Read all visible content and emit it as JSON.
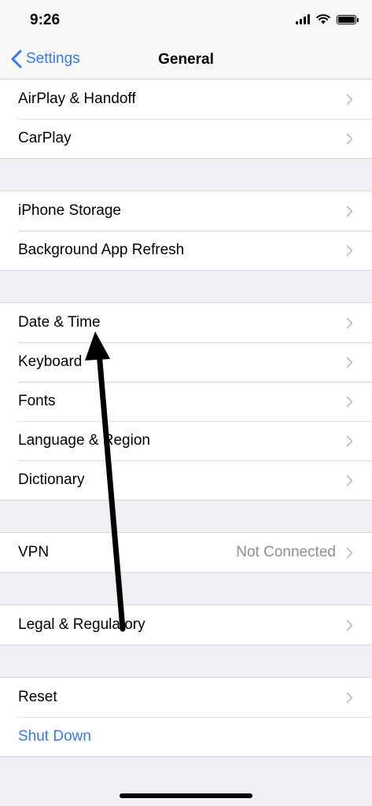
{
  "status_bar": {
    "time": "9:26"
  },
  "nav": {
    "back_label": "Settings",
    "title": "General"
  },
  "groups": {
    "g1": [
      {
        "label": "AirPlay & Handoff"
      },
      {
        "label": "CarPlay"
      }
    ],
    "g2": [
      {
        "label": "iPhone Storage"
      },
      {
        "label": "Background App Refresh"
      }
    ],
    "g3": [
      {
        "label": "Date & Time"
      },
      {
        "label": "Keyboard"
      },
      {
        "label": "Fonts"
      },
      {
        "label": "Language & Region"
      },
      {
        "label": "Dictionary"
      }
    ],
    "g4": [
      {
        "label": "VPN",
        "value": "Not Connected"
      }
    ],
    "g5": [
      {
        "label": "Legal & Regulatory"
      }
    ],
    "g6": [
      {
        "label": "Reset"
      },
      {
        "label": "Shut Down"
      }
    ]
  },
  "colors": {
    "accent": "#3478f6",
    "background": "#efeff4",
    "secondary_text": "#8e8e93",
    "annotation_arrow": "#000000"
  },
  "icons": [
    "back-chevron-icon",
    "chevron-right-icon",
    "cellular-signal-icon",
    "wifi-icon",
    "battery-icon",
    "annotation-arrow"
  ]
}
